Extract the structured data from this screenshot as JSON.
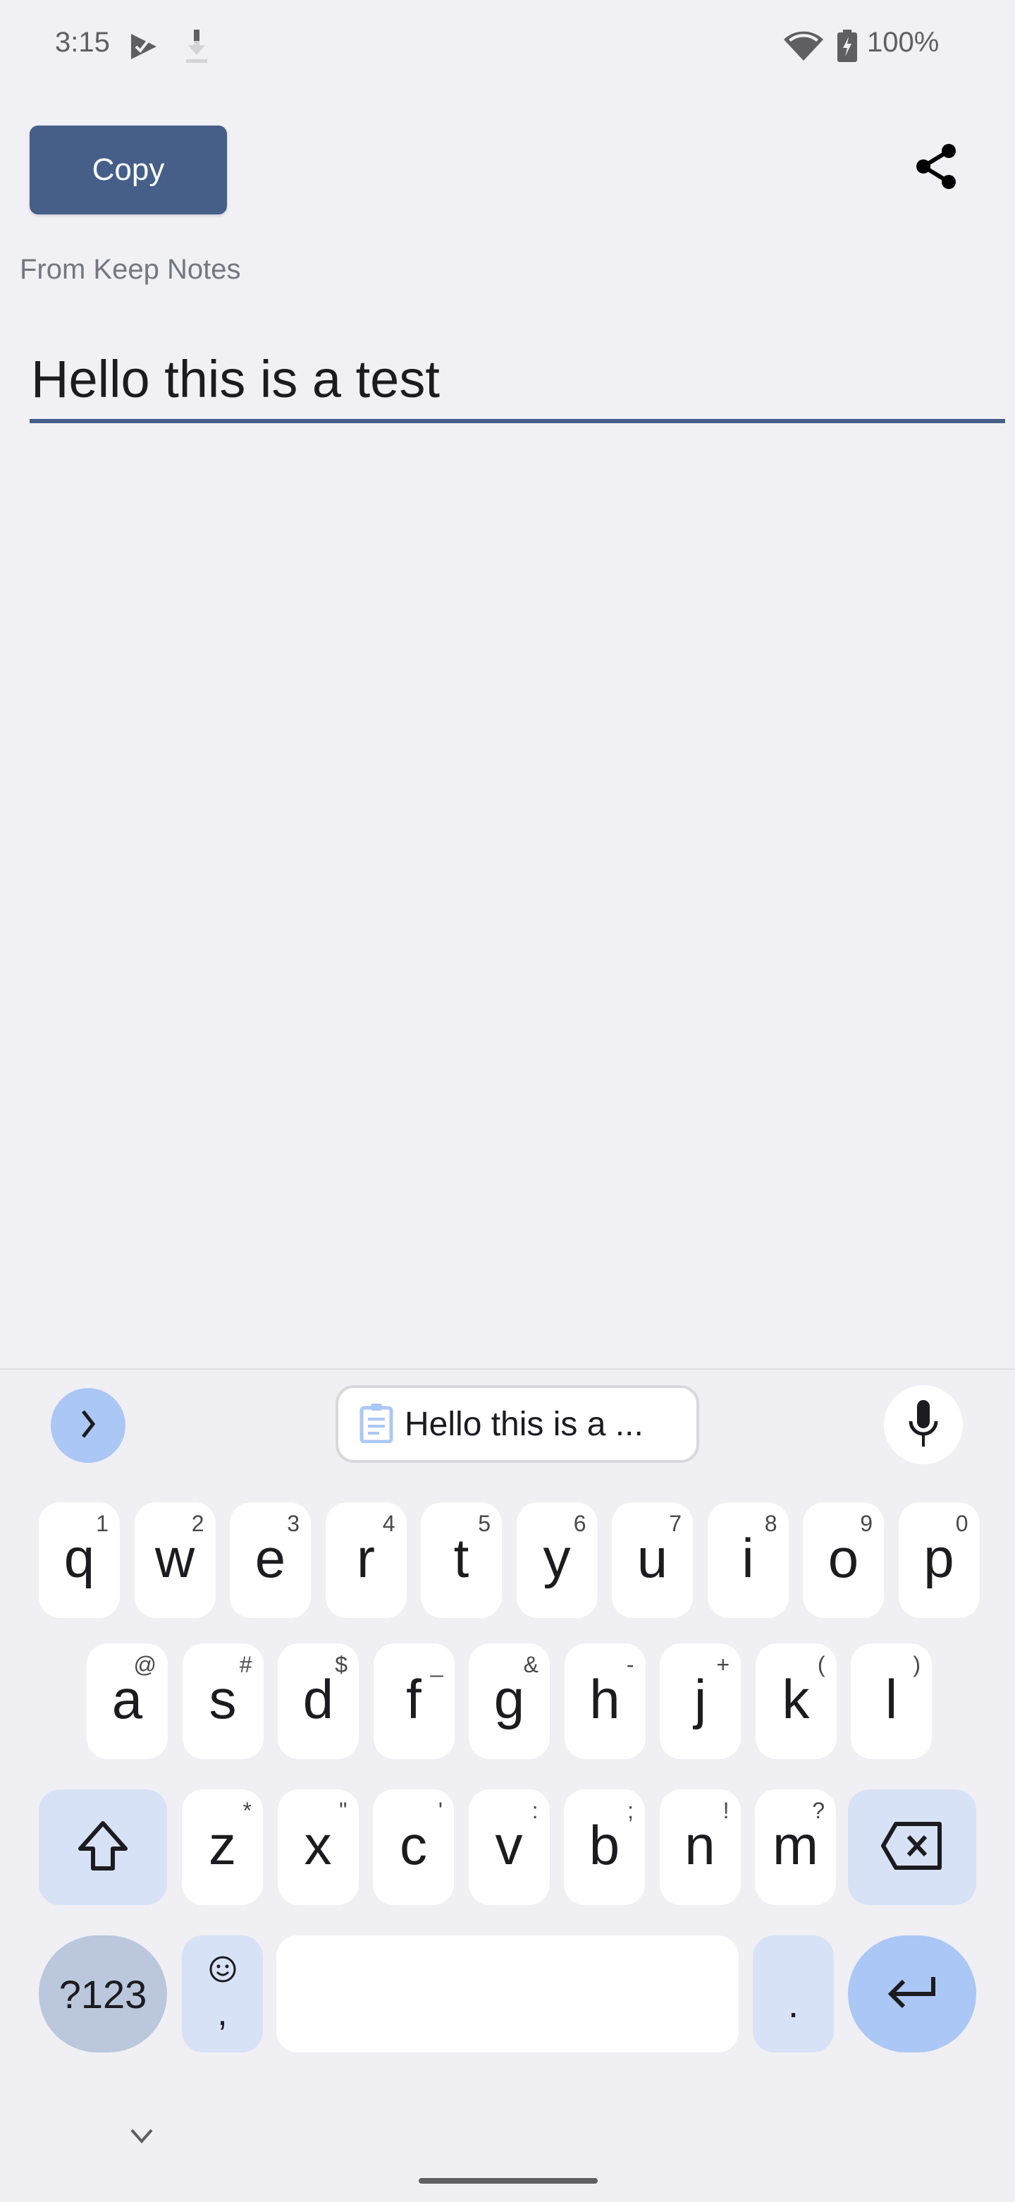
{
  "status_bar": {
    "time": "3:15",
    "left_icons": [
      "play-protect-icon",
      "download-icon"
    ],
    "right_icons": [
      "wifi-icon",
      "battery-charging-icon"
    ],
    "battery_percent": "100%"
  },
  "top_bar": {
    "copy_label": "Copy",
    "share_icon": "share-icon"
  },
  "content": {
    "source_label": "From Keep Notes",
    "note_text": "Hello this is a test",
    "accent_color": "#455f89"
  },
  "keyboard": {
    "toolbar": {
      "expand_icon": "chevron-right-icon",
      "clipboard_chip_text": "Hello this is a ...",
      "clipboard_icon": "clipboard-icon",
      "mic_icon": "microphone-icon"
    },
    "rows": [
      [
        {
          "key": "q",
          "hint": "1"
        },
        {
          "key": "w",
          "hint": "2"
        },
        {
          "key": "e",
          "hint": "3"
        },
        {
          "key": "r",
          "hint": "4"
        },
        {
          "key": "t",
          "hint": "5"
        },
        {
          "key": "y",
          "hint": "6"
        },
        {
          "key": "u",
          "hint": "7"
        },
        {
          "key": "i",
          "hint": "8"
        },
        {
          "key": "o",
          "hint": "9"
        },
        {
          "key": "p",
          "hint": "0"
        }
      ],
      [
        {
          "key": "a",
          "hint": "@"
        },
        {
          "key": "s",
          "hint": "#"
        },
        {
          "key": "d",
          "hint": "$"
        },
        {
          "key": "f",
          "hint": "_"
        },
        {
          "key": "g",
          "hint": "&"
        },
        {
          "key": "h",
          "hint": "-"
        },
        {
          "key": "j",
          "hint": "+"
        },
        {
          "key": "k",
          "hint": "("
        },
        {
          "key": "l",
          "hint": ")"
        }
      ],
      [
        {
          "key": "z",
          "hint": "*"
        },
        {
          "key": "x",
          "hint": "\""
        },
        {
          "key": "c",
          "hint": "'"
        },
        {
          "key": "v",
          "hint": ":"
        },
        {
          "key": "b",
          "hint": ";"
        },
        {
          "key": "n",
          "hint": "!"
        },
        {
          "key": "m",
          "hint": "?"
        }
      ]
    ],
    "symbols_label": "?123",
    "comma_label": ",",
    "period_label": ".",
    "key_colors": {
      "letter": "#ffffff",
      "modifier": "#d8e2f6",
      "enter": "#abc7f5",
      "symbols": "#bac7dc"
    }
  }
}
